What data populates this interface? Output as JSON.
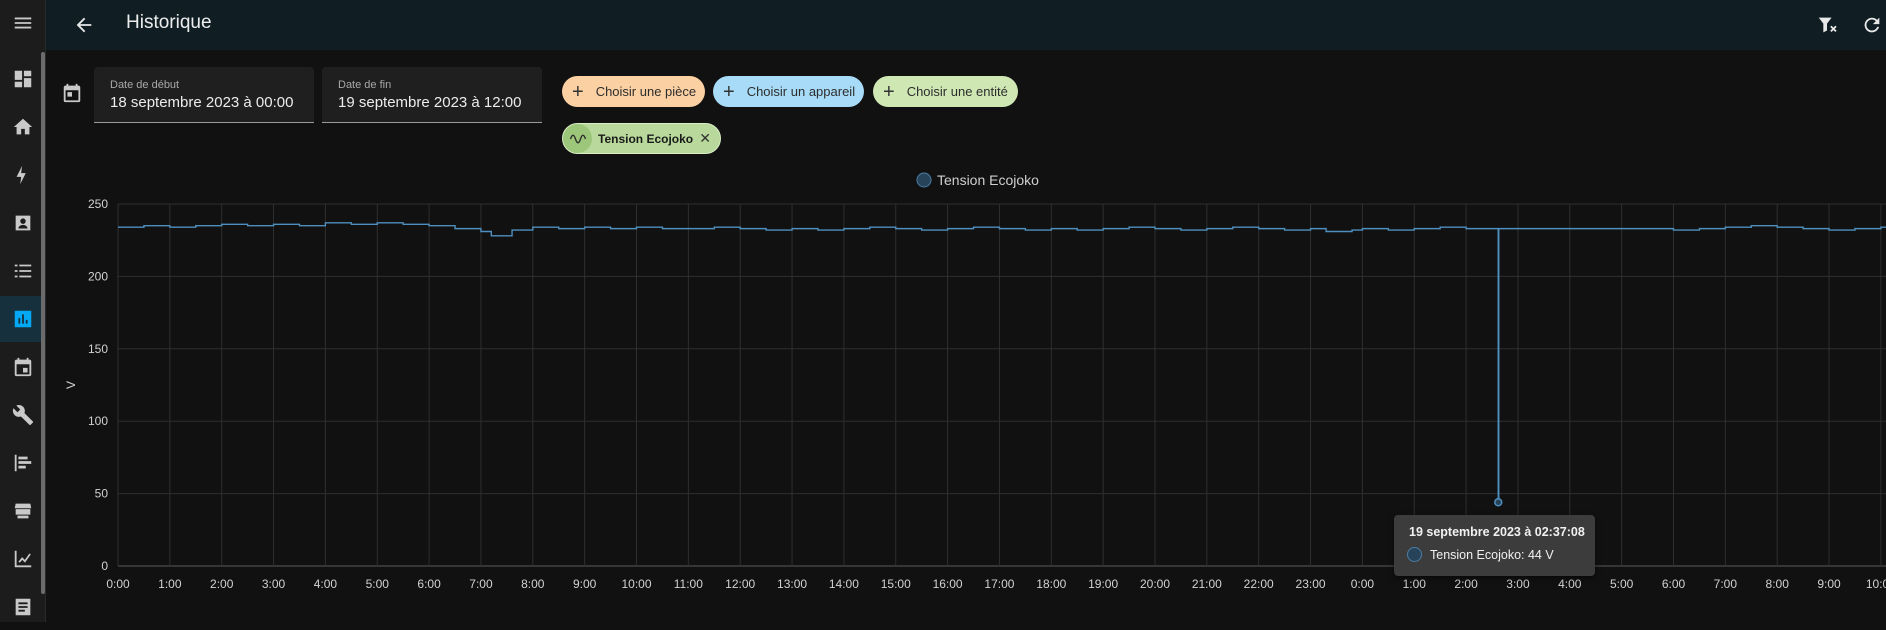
{
  "header": {
    "title": "Historique"
  },
  "sidebar": {
    "icons": [
      "menu-icon",
      "overview-icon",
      "home-icon",
      "energy-icon",
      "logbook-icon",
      "todo-list-icon",
      "history-icon",
      "calendar-icon",
      "wrench-icon",
      "tree-icon",
      "hacs-icon",
      "chart-icon",
      "notes-icon"
    ],
    "active": "history-icon"
  },
  "dates": {
    "start_label": "Date de début",
    "start_value": "18 septembre 2023 à 00:00",
    "end_label": "Date de fin",
    "end_value": "19 septembre 2023 à 12:00"
  },
  "pickers": {
    "room": "Choisir une pièce",
    "device": "Choisir un appareil",
    "entity": "Choisir une entité",
    "room_color": "#fbd0a2",
    "device_color": "#a7dbf7",
    "entity_color": "#cfe8b3"
  },
  "selected": {
    "entity": "Tension Ecojoko"
  },
  "tooltip": {
    "title": "19 septembre 2023 à 02:37:08",
    "value": "Tension Ecojoko: 44 V"
  },
  "chart_data": {
    "type": "line",
    "legend": "Tension Ecojoko",
    "ylabel": "V",
    "ylim": [
      0,
      250
    ],
    "yticks": [
      0,
      50,
      100,
      150,
      200,
      250
    ],
    "xticks": [
      "0:00",
      "1:00",
      "2:00",
      "3:00",
      "4:00",
      "5:00",
      "6:00",
      "7:00",
      "8:00",
      "9:00",
      "10:00",
      "11:00",
      "12:00",
      "13:00",
      "14:00",
      "15:00",
      "16:00",
      "17:00",
      "18:00",
      "19:00",
      "20:00",
      "21:00",
      "22:00",
      "23:00",
      "0:00",
      "1:00",
      "2:00",
      "3:00",
      "4:00",
      "5:00",
      "6:00",
      "7:00",
      "8:00",
      "9:00",
      "10:00"
    ],
    "series": [
      {
        "name": "Tension Ecojoko",
        "color": "#4e8fbf",
        "points": [
          [
            0,
            234
          ],
          [
            0.5,
            235
          ],
          [
            1,
            234
          ],
          [
            1.5,
            235
          ],
          [
            2,
            236
          ],
          [
            2.5,
            235
          ],
          [
            3,
            236
          ],
          [
            3.5,
            235
          ],
          [
            4,
            237
          ],
          [
            4.5,
            236
          ],
          [
            5,
            237
          ],
          [
            5.5,
            236
          ],
          [
            6,
            235
          ],
          [
            6.5,
            233
          ],
          [
            7,
            231
          ],
          [
            7.2,
            228
          ],
          [
            7.6,
            232
          ],
          [
            8,
            234
          ],
          [
            8.5,
            233
          ],
          [
            9,
            234
          ],
          [
            9.5,
            233
          ],
          [
            10,
            234
          ],
          [
            10.5,
            233
          ],
          [
            11,
            233
          ],
          [
            11.5,
            234
          ],
          [
            12,
            233
          ],
          [
            12.5,
            232
          ],
          [
            13,
            233
          ],
          [
            13.5,
            232
          ],
          [
            14,
            233
          ],
          [
            14.5,
            234
          ],
          [
            15,
            233
          ],
          [
            15.5,
            232
          ],
          [
            16,
            233
          ],
          [
            16.5,
            234
          ],
          [
            17,
            233
          ],
          [
            17.5,
            232
          ],
          [
            18,
            233
          ],
          [
            18.5,
            232
          ],
          [
            19,
            233
          ],
          [
            19.5,
            234
          ],
          [
            20,
            233
          ],
          [
            20.5,
            232
          ],
          [
            21,
            233
          ],
          [
            21.5,
            234
          ],
          [
            22,
            233
          ],
          [
            22.5,
            232
          ],
          [
            23,
            233
          ],
          [
            23.3,
            231
          ],
          [
            23.8,
            232
          ],
          [
            24,
            233
          ],
          [
            24.5,
            232
          ],
          [
            25,
            233
          ],
          [
            25.5,
            234
          ],
          [
            26,
            233
          ],
          [
            26.62,
            233
          ],
          [
            26.62,
            44
          ],
          [
            26.63,
            233
          ],
          [
            27,
            233
          ],
          [
            28,
            233
          ],
          [
            29,
            233
          ],
          [
            29.4,
            233
          ],
          [
            30,
            232
          ],
          [
            30.5,
            233
          ],
          [
            31,
            234
          ],
          [
            31.5,
            235
          ],
          [
            32,
            234
          ],
          [
            32.5,
            233
          ],
          [
            33,
            232
          ],
          [
            33.5,
            233
          ],
          [
            34,
            234
          ],
          [
            34.5,
            233
          ],
          [
            35,
            233
          ]
        ]
      }
    ]
  }
}
